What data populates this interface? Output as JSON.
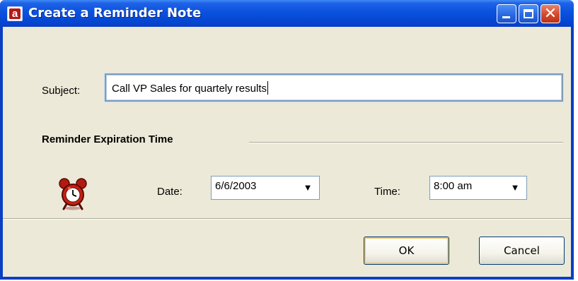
{
  "window": {
    "title": "Create a Reminder Note",
    "app_icon_letter": "a",
    "close_glyph": "✕"
  },
  "form": {
    "subject_label": "Subject:",
    "subject_value": "Call VP Sales for quartely results",
    "section_heading": "Reminder Expiration Time",
    "date_label": "Date:",
    "date_value": "6/6/2003",
    "time_label": "Time:",
    "time_value": "8:00 am",
    "dropdown_arrow": "▼",
    "alarm_icon": "alarm-clock-icon"
  },
  "buttons": {
    "ok_label": "OK",
    "cancel_label": "Cancel"
  },
  "colors": {
    "titlebar": "#0a52de",
    "client_bg": "#ece9d8",
    "close_button": "#d4492a",
    "input_border": "#7f9db9"
  }
}
